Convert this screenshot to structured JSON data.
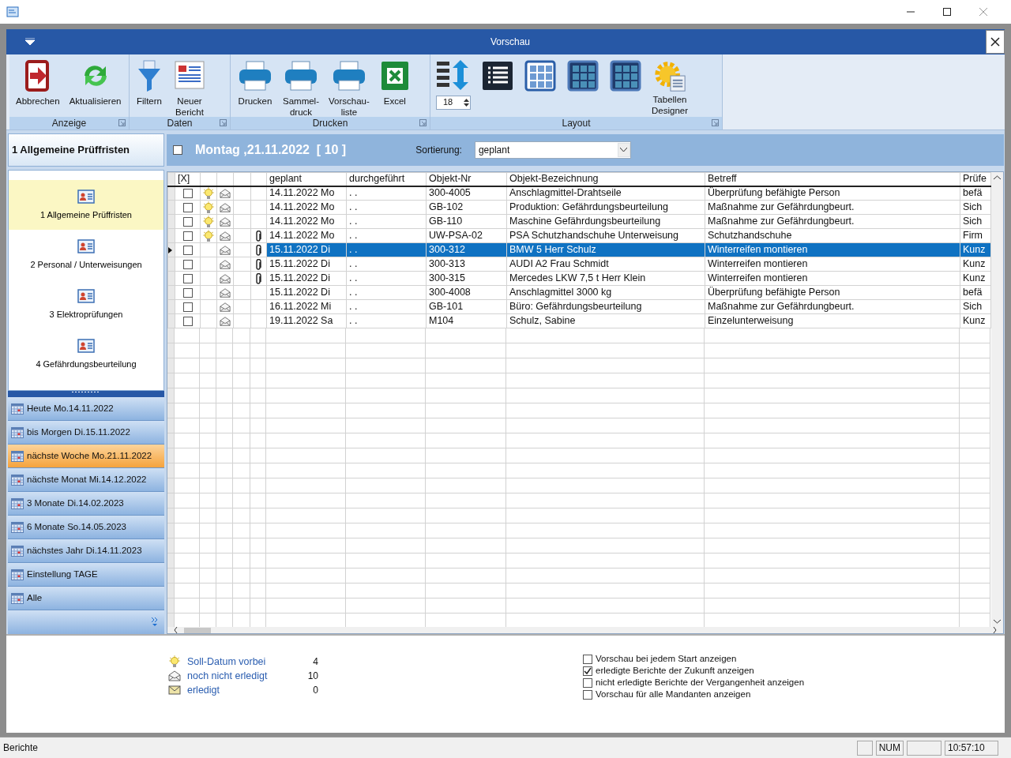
{
  "window": {
    "title": "Vorschau"
  },
  "ribbon": {
    "groups": [
      {
        "label": "Anzeige",
        "buttons": [
          {
            "kind": "exit",
            "label": "Abbrechen"
          },
          {
            "kind": "refresh",
            "label": "Aktualisieren"
          }
        ]
      },
      {
        "label": "Daten",
        "buttons": [
          {
            "kind": "filter",
            "label": "Filtern"
          },
          {
            "kind": "report",
            "label": "Neuer\nBericht"
          }
        ]
      },
      {
        "label": "Drucken",
        "buttons": [
          {
            "kind": "printer",
            "label": "Drucken"
          },
          {
            "kind": "printer",
            "label": "Sammel-\ndruck"
          },
          {
            "kind": "printer",
            "label": "Vorschau-\nliste"
          },
          {
            "kind": "excel",
            "label": "Excel"
          }
        ]
      },
      {
        "label": "Layout",
        "buttons": [
          {
            "kind": "row-height",
            "spin": "18"
          },
          {
            "kind": "list"
          },
          {
            "kind": "grid-light"
          },
          {
            "kind": "grid-dark"
          },
          {
            "kind": "grid-dark"
          },
          {
            "kind": "designer",
            "label": "Tabellen\nDesigner"
          }
        ]
      }
    ]
  },
  "sidebar": {
    "title": "1 Allgemeine Prüffristen",
    "categories": [
      {
        "label": "1 Allgemeine Prüffristen",
        "selected": true
      },
      {
        "label": "2 Personal / Unterweisungen",
        "selected": false
      },
      {
        "label": "3 Elektroprüfungen",
        "selected": false
      },
      {
        "label": "4 Gefährdungsbeurteilung",
        "selected": false
      }
    ],
    "periods": [
      {
        "label": "Heute Mo.14.11.2022",
        "selected": false
      },
      {
        "label": "bis Morgen Di.15.11.2022",
        "selected": false
      },
      {
        "label": "nächste Woche Mo.21.11.2022",
        "selected": true
      },
      {
        "label": "nächste Monat Mi.14.12.2022",
        "selected": false
      },
      {
        "label": "3 Monate Di.14.02.2023",
        "selected": false
      },
      {
        "label": "6 Monate So.14.05.2023",
        "selected": false
      },
      {
        "label": "nächstes Jahr Di.14.11.2023",
        "selected": false
      },
      {
        "label": "Einstellung TAGE",
        "selected": false
      },
      {
        "label": "Alle",
        "selected": false
      }
    ]
  },
  "list_header": {
    "checked": false,
    "title": "Montag ,21.11.2022  [ 10 ]",
    "sort_label": "Sortierung:",
    "sort_value": "geplant"
  },
  "table": {
    "columns": [
      "[X]",
      "geplant",
      "durchgeführt",
      "Objekt-Nr",
      "Objekt-Bezeichnung",
      "Betreff",
      "Prüfe"
    ],
    "rows": [
      {
        "checked": false,
        "overdue": true,
        "attachment": false,
        "selected": false,
        "geplant": "14.11.2022 Mo",
        "durchgefuehrt": ". .",
        "objekt_nr": "300-4005",
        "bezeichnung": "Anschlagmittel-Drahtseile",
        "betreff": "Überprüfung befähigte Person",
        "pruefe": "befä"
      },
      {
        "checked": false,
        "overdue": true,
        "attachment": false,
        "selected": false,
        "geplant": "14.11.2022 Mo",
        "durchgefuehrt": ". .",
        "objekt_nr": "GB-102",
        "bezeichnung": "Produktion: Gefährdungsbeurteilung",
        "betreff": "Maßnahme zur Gefährdungbeurt.",
        "pruefe": "Sich"
      },
      {
        "checked": false,
        "overdue": true,
        "attachment": false,
        "selected": false,
        "geplant": "14.11.2022 Mo",
        "durchgefuehrt": ". .",
        "objekt_nr": "GB-110",
        "bezeichnung": "Maschine Gefährdungsbeurteilung",
        "betreff": "Maßnahme zur Gefährdungbeurt.",
        "pruefe": "Sich"
      },
      {
        "checked": false,
        "overdue": true,
        "attachment": true,
        "selected": false,
        "geplant": "14.11.2022 Mo",
        "durchgefuehrt": ". .",
        "objekt_nr": "UW-PSA-02",
        "bezeichnung": "PSA Schutzhandschuhe Unterweisung",
        "betreff": "Schutzhandschuhe",
        "pruefe": "Firm"
      },
      {
        "checked": false,
        "overdue": false,
        "attachment": true,
        "selected": true,
        "geplant": "15.11.2022 Di",
        "durchgefuehrt": ". .",
        "objekt_nr": "300-312",
        "bezeichnung": "BMW 5 Herr Schulz",
        "betreff": "Winterreifen montieren",
        "pruefe": "Kunz"
      },
      {
        "checked": false,
        "overdue": false,
        "attachment": true,
        "selected": false,
        "geplant": "15.11.2022 Di",
        "durchgefuehrt": ". .",
        "objekt_nr": "300-313",
        "bezeichnung": "AUDI A2 Frau Schmidt",
        "betreff": "Winterreifen montieren",
        "pruefe": "Kunz"
      },
      {
        "checked": false,
        "overdue": false,
        "attachment": true,
        "selected": false,
        "geplant": "15.11.2022 Di",
        "durchgefuehrt": ". .",
        "objekt_nr": "300-315",
        "bezeichnung": "Mercedes LKW 7,5 t Herr Klein",
        "betreff": "Winterreifen montieren",
        "pruefe": "Kunz"
      },
      {
        "checked": false,
        "overdue": false,
        "attachment": false,
        "selected": false,
        "geplant": "15.11.2022 Di",
        "durchgefuehrt": ". .",
        "objekt_nr": "300-4008",
        "bezeichnung": "Anschlagmittel 3000 kg",
        "betreff": "Überprüfung befähigte Person",
        "pruefe": "befä"
      },
      {
        "checked": false,
        "overdue": false,
        "attachment": false,
        "selected": false,
        "geplant": "16.11.2022 Mi",
        "durchgefuehrt": ". .",
        "objekt_nr": "GB-101",
        "bezeichnung": "Büro: Gefährdungsbeurteilung",
        "betreff": "Maßnahme zur Gefährdungbeurt.",
        "pruefe": "Sich"
      },
      {
        "checked": false,
        "overdue": false,
        "attachment": false,
        "selected": false,
        "geplant": "19.11.2022 Sa",
        "durchgefuehrt": ". .",
        "objekt_nr": "M104",
        "bezeichnung": "Schulz, Sabine",
        "betreff": "Einzelunterweisung",
        "pruefe": "Kunz"
      }
    ]
  },
  "legend": [
    {
      "kind": "overdue",
      "label": "Soll-Datum vorbei",
      "count": "4"
    },
    {
      "kind": "open",
      "label": "noch nicht erledigt",
      "count": "10"
    },
    {
      "kind": "done",
      "label": "erledigt",
      "count": "0"
    }
  ],
  "options": [
    {
      "label": "Vorschau bei jedem Start anzeigen",
      "checked": false
    },
    {
      "label": "erledigte Berichte der Zukunft anzeigen",
      "checked": true
    },
    {
      "label": "nicht erledigte Berichte der Vergangenheit anzeigen",
      "checked": false
    },
    {
      "label": "Vorschau für alle Mandanten anzeigen",
      "checked": false
    }
  ],
  "status_bar": {
    "text": "Berichte",
    "num": "NUM",
    "time": "10:57:10"
  }
}
